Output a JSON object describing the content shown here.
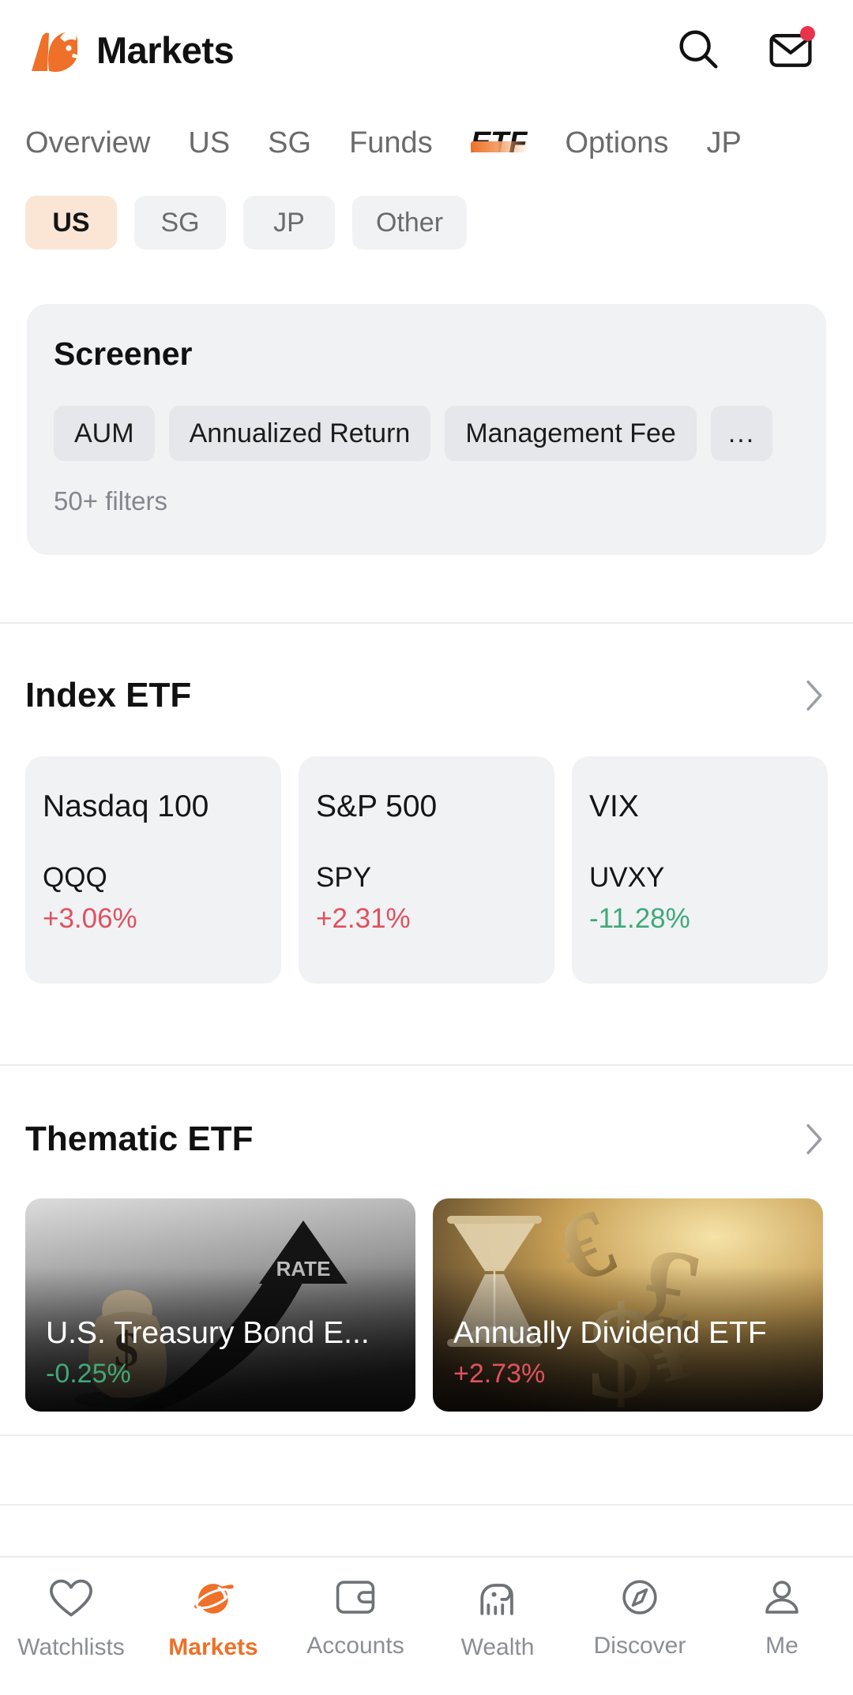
{
  "header": {
    "logo_icon": "bull-logo-icon",
    "title": "Markets",
    "search_icon": "search-icon",
    "mail_icon": "mail-icon",
    "has_unread_badge": true,
    "brand_color": "#ef7028"
  },
  "tabs": [
    {
      "label": "Overview",
      "active": false
    },
    {
      "label": "US",
      "active": false
    },
    {
      "label": "SG",
      "active": false
    },
    {
      "label": "Funds",
      "active": false
    },
    {
      "label": "ETF",
      "active": true
    },
    {
      "label": "Options",
      "active": false
    },
    {
      "label": "JP",
      "active": false
    }
  ],
  "region_chips": [
    {
      "label": "US",
      "active": true
    },
    {
      "label": "SG",
      "active": false
    },
    {
      "label": "JP",
      "active": false
    },
    {
      "label": "Other",
      "active": false
    }
  ],
  "screener": {
    "title": "Screener",
    "tags": [
      "AUM",
      "Annualized Return",
      "Management Fee"
    ],
    "more_label": "...",
    "filters_count_label": "50+ filters"
  },
  "index_etf": {
    "title": "Index ETF",
    "chevron_icon": "chevron-right-icon",
    "cards": [
      {
        "name": "Nasdaq 100",
        "ticker": "QQQ",
        "change": "+3.06%",
        "direction": "up"
      },
      {
        "name": "S&P 500",
        "ticker": "SPY",
        "change": "+2.31%",
        "direction": "up"
      },
      {
        "name": "VIX",
        "ticker": "UVXY",
        "change": "-11.28%",
        "direction": "down"
      }
    ]
  },
  "thematic_etf": {
    "title": "Thematic ETF",
    "chevron_icon": "chevron-right-icon",
    "cards": [
      {
        "title": "U.S. Treasury Bond E...",
        "change": "-0.25%",
        "direction": "down",
        "art": "money-bag-rate-arrow",
        "art_label": "RATE"
      },
      {
        "title": "Annually Dividend ETF",
        "change": "+2.73%",
        "direction": "up",
        "art": "hourglass-dollar-signs"
      }
    ]
  },
  "bottom_nav": [
    {
      "label": "Watchlists",
      "icon": "heart-icon",
      "active": false
    },
    {
      "label": "Markets",
      "icon": "planet-icon",
      "active": true
    },
    {
      "label": "Accounts",
      "icon": "wallet-icon",
      "active": false
    },
    {
      "label": "Wealth",
      "icon": "elephant-icon",
      "active": false
    },
    {
      "label": "Discover",
      "icon": "compass-icon",
      "active": false
    },
    {
      "label": "Me",
      "icon": "person-icon",
      "active": false
    }
  ],
  "colors": {
    "accent": "#ef7028",
    "positive": "#e0515f",
    "negative": "#3fa87a",
    "chip_bg": "#f1f2f4",
    "chip_active_bg": "#fbe6d6"
  }
}
